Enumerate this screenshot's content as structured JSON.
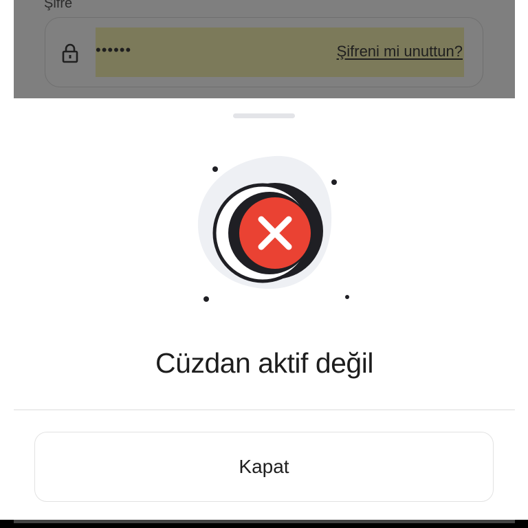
{
  "background_form": {
    "password_label": "Şifre",
    "password_value": "••••••",
    "forgot_password_link": "Şifreni mi unuttun?",
    "lock_icon": "lock-icon"
  },
  "sheet": {
    "illustration_icon": "error-x-icon",
    "title": "Cüzdan aktif değil",
    "close_button_label": "Kapat"
  },
  "colors": {
    "error_red": "#ea4233",
    "dark": "#1f1f24",
    "overlay": "#7f7f7f",
    "autofill_highlight": "#7c7a5a"
  }
}
